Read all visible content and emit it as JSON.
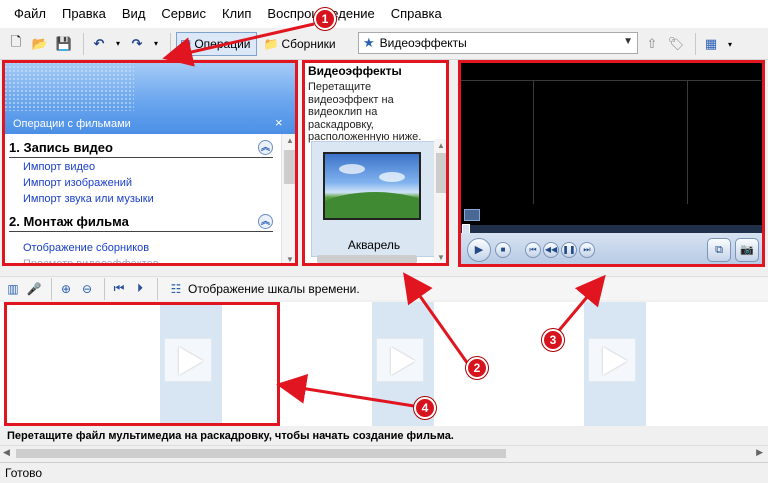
{
  "menu": [
    "Файл",
    "Правка",
    "Вид",
    "Сервис",
    "Клип",
    "Воспроизведение",
    "Справка"
  ],
  "toolbar": {
    "tasks_label": "Операции",
    "collections_label": "Сборники",
    "collection_selected": "Видеоэффекты"
  },
  "tasks_pane": {
    "title": "Операции с фильмами",
    "close": "×",
    "sections": [
      {
        "title": "1. Запись видео",
        "links": [
          "Импорт видео",
          "Импорт изображений",
          "Импорт звука или музыки"
        ]
      },
      {
        "title": "2. Монтаж фильма",
        "links": [
          "Отображение сборников",
          "Просмотр видеоэффектов"
        ]
      }
    ]
  },
  "effects_pane": {
    "title": "Видеоэффекты",
    "hint": "Перетащите видеоэффект на видеоклип на раскадровку, расположенную ниже.",
    "item_label": "Акварель"
  },
  "storyboard": {
    "toggle_label": "Отображение шкалы времени.",
    "hint": "Перетащите файл мультимедиа на раскадровку, чтобы начать создание фильма."
  },
  "status": "Готово",
  "annotations": [
    "1",
    "2",
    "3",
    "4"
  ],
  "colors": {
    "highlight": "#e0151f",
    "link": "#1a3fc9",
    "header_blue": "#4b8fe6"
  }
}
